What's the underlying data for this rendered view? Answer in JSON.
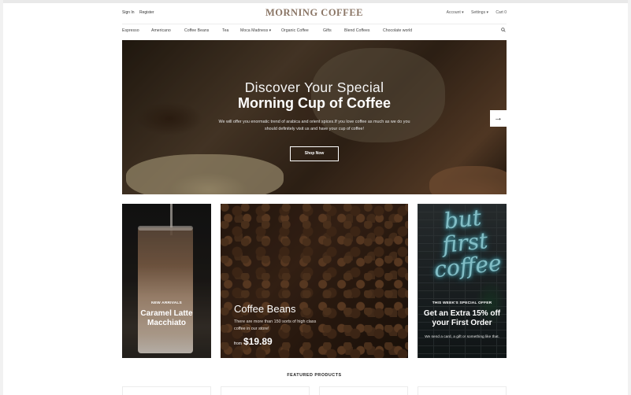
{
  "header": {
    "sign_in": "Sign In",
    "register": "Register",
    "logo": "MORNING COFFEE",
    "account": "Account ▾",
    "settings": "Settings ▾",
    "cart": "Cart 0"
  },
  "nav": {
    "items": [
      "Espresso",
      "Americano",
      "Coffee Beans",
      "Tea",
      "Moca Madness ▾",
      "Organic Coffee",
      "Gifts",
      "Blend Coffees",
      "Chocolate world"
    ],
    "search_icon": "search-icon"
  },
  "hero": {
    "title_line1": "Discover Your Special",
    "title_line2": "Morning Cup of Coffee",
    "description": "We will offer you enormatic trend of arabica and orient spices.If you love coffee as much as we do you should definitely visit us and have your cup of coffee!",
    "button": "Shop Now",
    "next_icon": "arrow-right-icon",
    "next_glyph": "→"
  },
  "promos": {
    "card1": {
      "kicker": "NEW ARRIVALS",
      "title": "Caramel Latte Macchiato"
    },
    "card2": {
      "title": "Coffee Beans",
      "description": "There are more than 150 sorts of high class coffee in our store!",
      "price_prefix": "from",
      "price": "$19.89"
    },
    "card3": {
      "neon": "but first coffee",
      "kicker": "THIS WEEK'S SPECIAL OFFER",
      "title": "Get an Extra 15% off your First Order",
      "description": "We send a card, a gift or something like that."
    }
  },
  "featured": {
    "heading": "FEATURED PRODUCTS"
  }
}
